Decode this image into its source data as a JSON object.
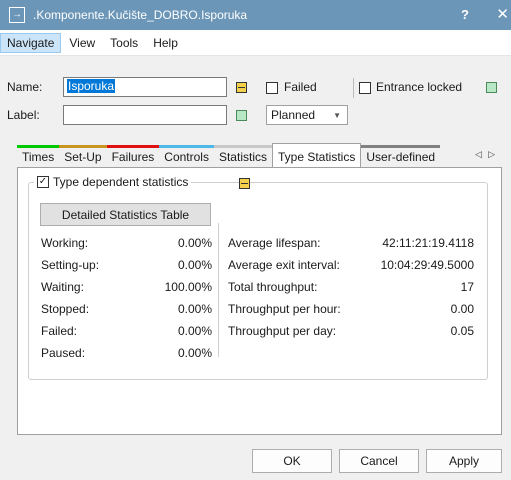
{
  "window": {
    "title": ".Komponente.Kučište_DOBRO.Isporuka",
    "help_label": "?",
    "close_label": "✕"
  },
  "menu": [
    "Navigate",
    "View",
    "Tools",
    "Help"
  ],
  "form": {
    "name_label": "Name:",
    "name_value": "Isporuka",
    "label_label": "Label:",
    "label_value": "",
    "failed_label": "Failed",
    "entrance_locked_label": "Entrance locked",
    "status_select": "Planned"
  },
  "tabs": [
    {
      "label": "Times",
      "color": "#00c800"
    },
    {
      "label": "Set-Up",
      "color": "#c8961e"
    },
    {
      "label": "Failures",
      "color": "#e01010"
    },
    {
      "label": "Controls",
      "color": "#50b8e6"
    },
    {
      "label": "Statistics",
      "color": "#c8c8c8"
    },
    {
      "label": "Type Statistics",
      "color": ""
    },
    {
      "label": "User-defined",
      "color": "#808080"
    }
  ],
  "type_stats": {
    "checkbox_label": "Type dependent statistics",
    "detail_button": "Detailed Statistics Table",
    "left": [
      {
        "label": "Working:",
        "value": "0.00%"
      },
      {
        "label": "Setting-up:",
        "value": "0.00%"
      },
      {
        "label": "Waiting:",
        "value": "100.00%"
      },
      {
        "label": "Stopped:",
        "value": "0.00%"
      },
      {
        "label": "Failed:",
        "value": "0.00%"
      },
      {
        "label": "Paused:",
        "value": "0.00%"
      }
    ],
    "right": [
      {
        "label": "Average lifespan:",
        "value": "42:11:21:19.4118"
      },
      {
        "label": "Average exit interval:",
        "value": "10:04:29:49.5000"
      },
      {
        "label": "Total throughput:",
        "value": "17"
      },
      {
        "label": "Throughput per hour:",
        "value": "0.00"
      },
      {
        "label": "Throughput per day:",
        "value": "0.05"
      }
    ]
  },
  "buttons": {
    "ok": "OK",
    "cancel": "Cancel",
    "apply": "Apply"
  },
  "colors": {
    "titlebar": "#6b96b8",
    "inherit_yellow": "#f5d04a",
    "inherit_green": "#b7e7c4"
  }
}
